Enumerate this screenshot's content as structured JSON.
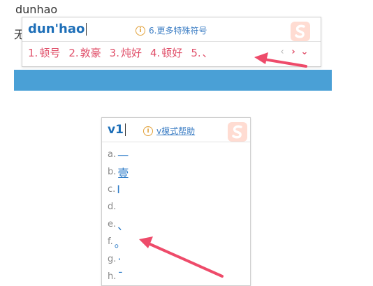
{
  "document": {
    "text_line": "dunhao",
    "fragment": "无"
  },
  "ime_top": {
    "pinyin": "dun'hao",
    "hint": "6.更多特殊符号",
    "candidates": [
      {
        "num": "1.",
        "text": "顿号"
      },
      {
        "num": "2.",
        "text": "敦豪"
      },
      {
        "num": "3.",
        "text": "炖好"
      },
      {
        "num": "4.",
        "text": "顿好"
      },
      {
        "num": "5.",
        "text": "、"
      }
    ],
    "prev_symbol": "‹",
    "next_symbol": "›",
    "expand_symbol": "⌄"
  },
  "ime_v": {
    "pinyin": "v1",
    "hint": "v模式帮助",
    "items": [
      {
        "letter": "a.",
        "symbol": "一"
      },
      {
        "letter": "b.",
        "symbol": "壹"
      },
      {
        "letter": "c.",
        "symbol": "Ⅰ"
      },
      {
        "letter": "d.",
        "symbol": ""
      },
      {
        "letter": "e.",
        "symbol": "、"
      },
      {
        "letter": "f.",
        "symbol": "。"
      },
      {
        "letter": "g.",
        "symbol": "·"
      },
      {
        "letter": "h.",
        "symbol": "¯"
      }
    ]
  },
  "colors": {
    "accent_blue": "#1e6fb8",
    "candidate_red": "#e0506a",
    "bar_blue": "#4aa0d6",
    "arrow_red": "#ee4b6a",
    "logo_bg": "#ffdcd2"
  },
  "icons": {
    "hint": "info-circle-icon",
    "logo": "sogou-s-logo-icon",
    "annotation": "red-arrow-icon"
  }
}
